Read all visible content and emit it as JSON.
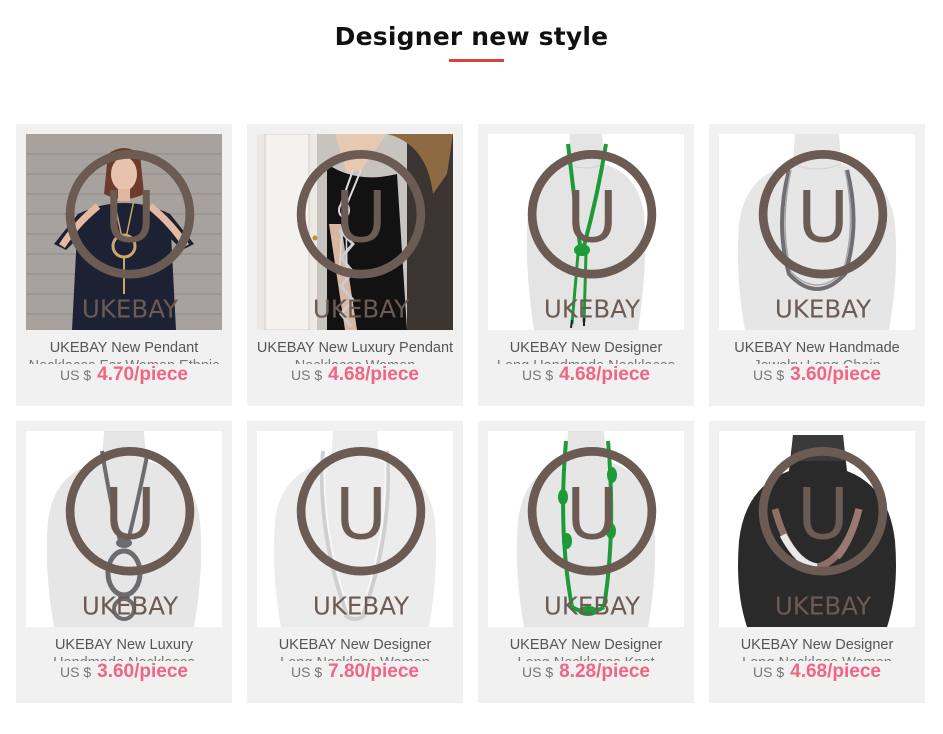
{
  "section": {
    "title": "Designer new style",
    "accent_color": "#d9413f"
  },
  "brand_logo": {
    "letter": "U",
    "text": "UKEBAY"
  },
  "products": [
    {
      "title": "UKEBAY New Pendant",
      "title_line2": "Necklaces For Women Ethnic",
      "currency": "US $",
      "price": "4.70/piece",
      "image": "woman-dark-dress-pendant"
    },
    {
      "title": "UKEBAY New Luxury Pendant",
      "title_line2": "Necklaces Women",
      "currency": "US $",
      "price": "4.68/piece",
      "image": "woman-black-dress-long-chain"
    },
    {
      "title": "UKEBAY New Designer",
      "title_line2": "Long Handmade Necklaces",
      "currency": "US $",
      "price": "4.68/piece",
      "image": "mannequin-green-knot-necklace"
    },
    {
      "title": "UKEBAY New Handmade",
      "title_line2": "Jewelry Long Chain",
      "currency": "US $",
      "price": "3.60/piece",
      "image": "mannequin-grey-chain-necklace"
    },
    {
      "title": "UKEBAY New Luxury",
      "title_line2": "Handmade Necklaces",
      "currency": "US $",
      "price": "3.60/piece",
      "image": "mannequin-grey-ring-pendant"
    },
    {
      "title": "UKEBAY New Designer",
      "title_line2": "Long Necklace Women",
      "currency": "US $",
      "price": "7.80/piece",
      "image": "mannequin-white-braided-necklace"
    },
    {
      "title": "UKEBAY New Designer",
      "title_line2": "Long Necklaces Knot",
      "currency": "US $",
      "price": "8.28/piece",
      "image": "mannequin-green-knotted-long-necklace"
    },
    {
      "title": "UKEBAY New Designer",
      "title_line2": "Long Necklace Women",
      "currency": "US $",
      "price": "4.68/piece",
      "image": "black-bust-choker-necklace"
    }
  ]
}
